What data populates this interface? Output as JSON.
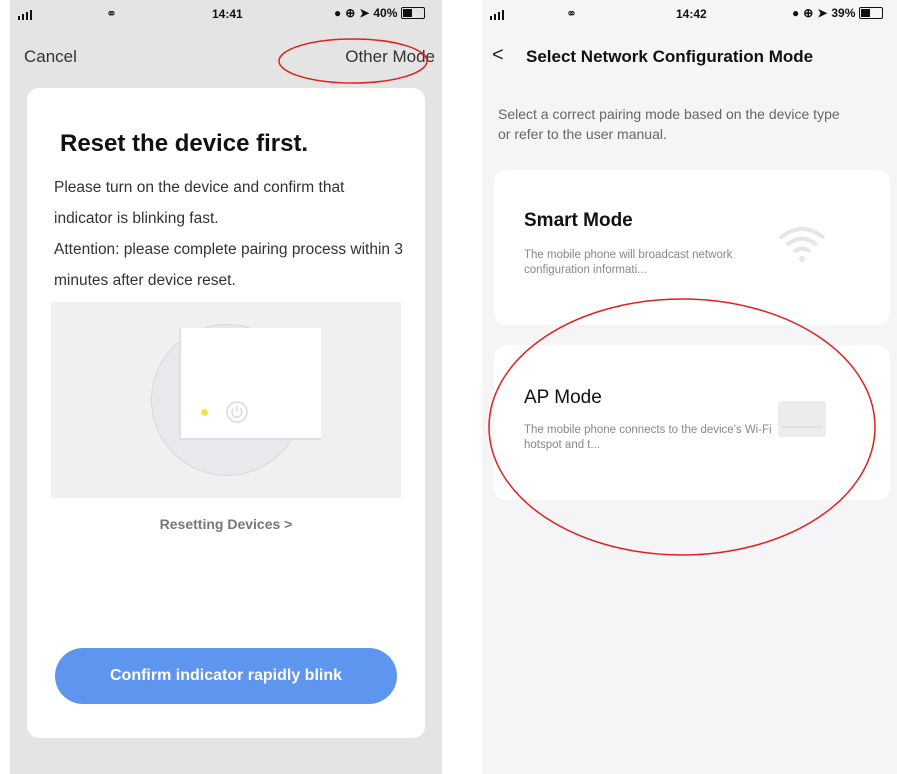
{
  "left_screen": {
    "status": {
      "time": "14:41",
      "battery": "40%",
      "battery_fill": 0.4
    },
    "nav": {
      "cancel": "Cancel",
      "other_mode": "Other Mode"
    },
    "card": {
      "title": "Reset the device first.",
      "desc_line1": "Please turn on the device and confirm that indicator is blinking fast.",
      "desc_line2": "Attention: please complete pairing process within 3 minutes after device reset.",
      "resetting_link": "Resetting Devices >",
      "confirm_button": "Confirm indicator rapidly blink"
    }
  },
  "right_screen": {
    "status": {
      "time": "14:42",
      "battery": "39%",
      "battery_fill": 0.39
    },
    "nav": {
      "back": "<",
      "title": "Select Network Configuration Mode"
    },
    "instruction": "Select a correct pairing mode based on the device type or refer to the user manual.",
    "modes": [
      {
        "title": "Smart Mode",
        "desc": "The mobile phone will broadcast network configuration informati...",
        "icon": "wifi-icon"
      },
      {
        "title": "AP Mode",
        "desc": "The mobile phone connects to the device's Wi-Fi hotspot and t...",
        "icon": "router-icon"
      }
    ]
  },
  "colors": {
    "accent_button": "#5e95ef",
    "annotation": "#e02020",
    "indicator": "#f5e34a"
  }
}
